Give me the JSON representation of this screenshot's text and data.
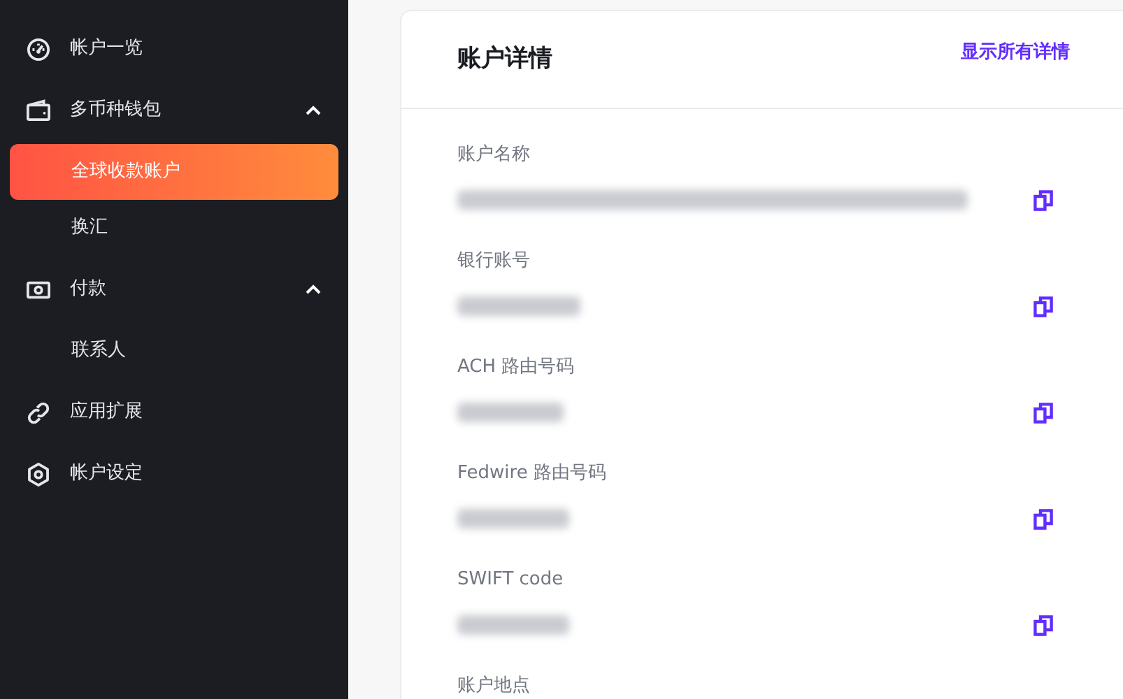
{
  "sidebar": {
    "items": [
      {
        "label": "帐户一览"
      },
      {
        "label": "多币种钱包",
        "expanded": true,
        "children": [
          {
            "label": "全球收款账户",
            "selected": true
          },
          {
            "label": "换汇",
            "selected": false
          }
        ]
      },
      {
        "label": "付款",
        "expanded": true,
        "children": [
          {
            "label": "联系人",
            "selected": false
          }
        ]
      },
      {
        "label": "应用扩展"
      },
      {
        "label": "帐户设定"
      }
    ]
  },
  "card": {
    "title": "账户详情",
    "link": "显示所有详情",
    "fields": [
      {
        "label": "账户名称",
        "kind": "hidden"
      },
      {
        "label": "银行账号",
        "kind": "hidden"
      },
      {
        "label": "ACH 路由号码",
        "kind": "hidden"
      },
      {
        "label": "Fedwire 路由号码",
        "kind": "hidden"
      },
      {
        "label": "SWIFT code",
        "kind": "hidden"
      },
      {
        "label": "账户地点",
        "kind": "label"
      }
    ]
  }
}
